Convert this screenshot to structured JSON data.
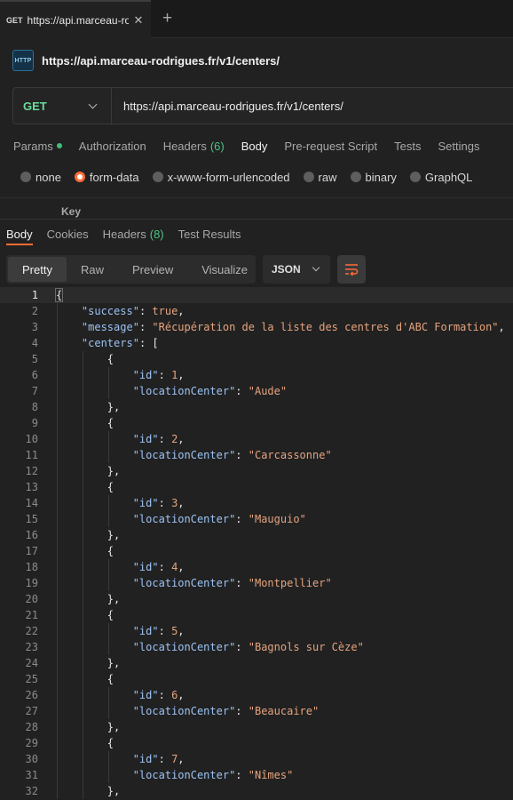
{
  "tabs": {
    "method": "GET",
    "title": "https://api.marceau-rodrigues.fr/v1/centers/",
    "close": "✕",
    "new_tab": "+"
  },
  "request": {
    "icon_label": "HTTP",
    "title": "https://api.marceau-rodrigues.fr/v1/centers/",
    "method": "GET",
    "url": "https://api.marceau-rodrigues.fr/v1/centers/"
  },
  "request_tabs": [
    {
      "label": "Params",
      "dot": true
    },
    {
      "label": "Authorization"
    },
    {
      "label": "Headers",
      "count": "(6)"
    },
    {
      "label": "Body",
      "active": true
    },
    {
      "label": "Pre-request Script"
    },
    {
      "label": "Tests"
    },
    {
      "label": "Settings"
    }
  ],
  "body_types": [
    {
      "label": "none",
      "selected": false
    },
    {
      "label": "form-data",
      "selected": true
    },
    {
      "label": "x-www-form-urlencoded",
      "selected": false
    },
    {
      "label": "raw",
      "selected": false
    },
    {
      "label": "binary",
      "selected": false
    },
    {
      "label": "GraphQL",
      "selected": false
    }
  ],
  "form_table": {
    "key_header": "Key"
  },
  "response_tabs": [
    {
      "label": "Body",
      "active": true
    },
    {
      "label": "Cookies"
    },
    {
      "label": "Headers",
      "count": "(8)"
    },
    {
      "label": "Test Results"
    }
  ],
  "view_modes": [
    "Pretty",
    "Raw",
    "Preview",
    "Visualize"
  ],
  "format": "JSON",
  "colors": {
    "accent": "#ff6c37",
    "method_get": "#6bdd9a",
    "key": "#9cc2f2",
    "string": "#e6a47e"
  },
  "code_lines": [
    [
      [
        "p",
        "{"
      ]
    ],
    [
      [
        "p",
        "    "
      ],
      [
        "k",
        "\"success\""
      ],
      [
        "p",
        ": "
      ],
      [
        "b",
        "true"
      ],
      [
        "p",
        ","
      ]
    ],
    [
      [
        "p",
        "    "
      ],
      [
        "k",
        "\"message\""
      ],
      [
        "p",
        ": "
      ],
      [
        "s",
        "\"Récupération de la liste des centres d'ABC Formation\""
      ],
      [
        "p",
        ","
      ]
    ],
    [
      [
        "p",
        "    "
      ],
      [
        "k",
        "\"centers\""
      ],
      [
        "p",
        ": ["
      ]
    ],
    [
      [
        "p",
        "        {"
      ]
    ],
    [
      [
        "p",
        "            "
      ],
      [
        "k",
        "\"id\""
      ],
      [
        "p",
        ": "
      ],
      [
        "n",
        "1"
      ],
      [
        "p",
        ","
      ]
    ],
    [
      [
        "p",
        "            "
      ],
      [
        "k",
        "\"locationCenter\""
      ],
      [
        "p",
        ": "
      ],
      [
        "s",
        "\"Aude\""
      ]
    ],
    [
      [
        "p",
        "        },"
      ]
    ],
    [
      [
        "p",
        "        {"
      ]
    ],
    [
      [
        "p",
        "            "
      ],
      [
        "k",
        "\"id\""
      ],
      [
        "p",
        ": "
      ],
      [
        "n",
        "2"
      ],
      [
        "p",
        ","
      ]
    ],
    [
      [
        "p",
        "            "
      ],
      [
        "k",
        "\"locationCenter\""
      ],
      [
        "p",
        ": "
      ],
      [
        "s",
        "\"Carcassonne\""
      ]
    ],
    [
      [
        "p",
        "        },"
      ]
    ],
    [
      [
        "p",
        "        {"
      ]
    ],
    [
      [
        "p",
        "            "
      ],
      [
        "k",
        "\"id\""
      ],
      [
        "p",
        ": "
      ],
      [
        "n",
        "3"
      ],
      [
        "p",
        ","
      ]
    ],
    [
      [
        "p",
        "            "
      ],
      [
        "k",
        "\"locationCenter\""
      ],
      [
        "p",
        ": "
      ],
      [
        "s",
        "\"Mauguio\""
      ]
    ],
    [
      [
        "p",
        "        },"
      ]
    ],
    [
      [
        "p",
        "        {"
      ]
    ],
    [
      [
        "p",
        "            "
      ],
      [
        "k",
        "\"id\""
      ],
      [
        "p",
        ": "
      ],
      [
        "n",
        "4"
      ],
      [
        "p",
        ","
      ]
    ],
    [
      [
        "p",
        "            "
      ],
      [
        "k",
        "\"locationCenter\""
      ],
      [
        "p",
        ": "
      ],
      [
        "s",
        "\"Montpellier\""
      ]
    ],
    [
      [
        "p",
        "        },"
      ]
    ],
    [
      [
        "p",
        "        {"
      ]
    ],
    [
      [
        "p",
        "            "
      ],
      [
        "k",
        "\"id\""
      ],
      [
        "p",
        ": "
      ],
      [
        "n",
        "5"
      ],
      [
        "p",
        ","
      ]
    ],
    [
      [
        "p",
        "            "
      ],
      [
        "k",
        "\"locationCenter\""
      ],
      [
        "p",
        ": "
      ],
      [
        "s",
        "\"Bagnols sur Cèze\""
      ]
    ],
    [
      [
        "p",
        "        },"
      ]
    ],
    [
      [
        "p",
        "        {"
      ]
    ],
    [
      [
        "p",
        "            "
      ],
      [
        "k",
        "\"id\""
      ],
      [
        "p",
        ": "
      ],
      [
        "n",
        "6"
      ],
      [
        "p",
        ","
      ]
    ],
    [
      [
        "p",
        "            "
      ],
      [
        "k",
        "\"locationCenter\""
      ],
      [
        "p",
        ": "
      ],
      [
        "s",
        "\"Beaucaire\""
      ]
    ],
    [
      [
        "p",
        "        },"
      ]
    ],
    [
      [
        "p",
        "        {"
      ]
    ],
    [
      [
        "p",
        "            "
      ],
      [
        "k",
        "\"id\""
      ],
      [
        "p",
        ": "
      ],
      [
        "n",
        "7"
      ],
      [
        "p",
        ","
      ]
    ],
    [
      [
        "p",
        "            "
      ],
      [
        "k",
        "\"locationCenter\""
      ],
      [
        "p",
        ": "
      ],
      [
        "s",
        "\"Nîmes\""
      ]
    ],
    [
      [
        "p",
        "        },"
      ]
    ]
  ]
}
